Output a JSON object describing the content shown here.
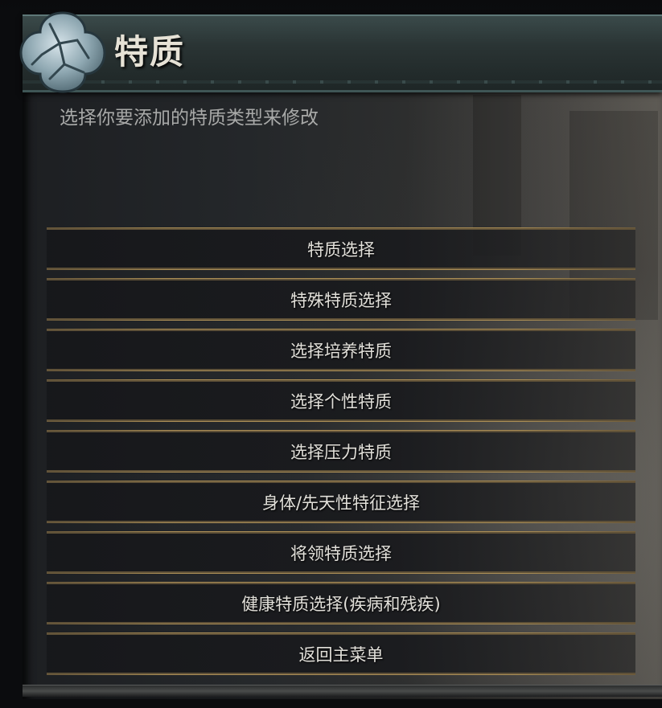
{
  "header": {
    "title": "特质",
    "emblem_icon": "stone-cracked-emblem-icon"
  },
  "subtitle": "选择你要添加的特质类型来修改",
  "menu": {
    "items": [
      {
        "label": "特质选择"
      },
      {
        "label": "特殊特质选择"
      },
      {
        "label": "选择培养特质"
      },
      {
        "label": "选择个性特质"
      },
      {
        "label": "选择压力特质"
      },
      {
        "label": "身体/先天性特征选择"
      },
      {
        "label": "将领特质选择"
      },
      {
        "label": "健康特质选择(疾病和残疾)"
      },
      {
        "label": "返回主菜单"
      }
    ]
  },
  "colors": {
    "accent_gold": "#5f5138",
    "text": "#e2e0da",
    "header_teal": "#3a4a4a"
  }
}
